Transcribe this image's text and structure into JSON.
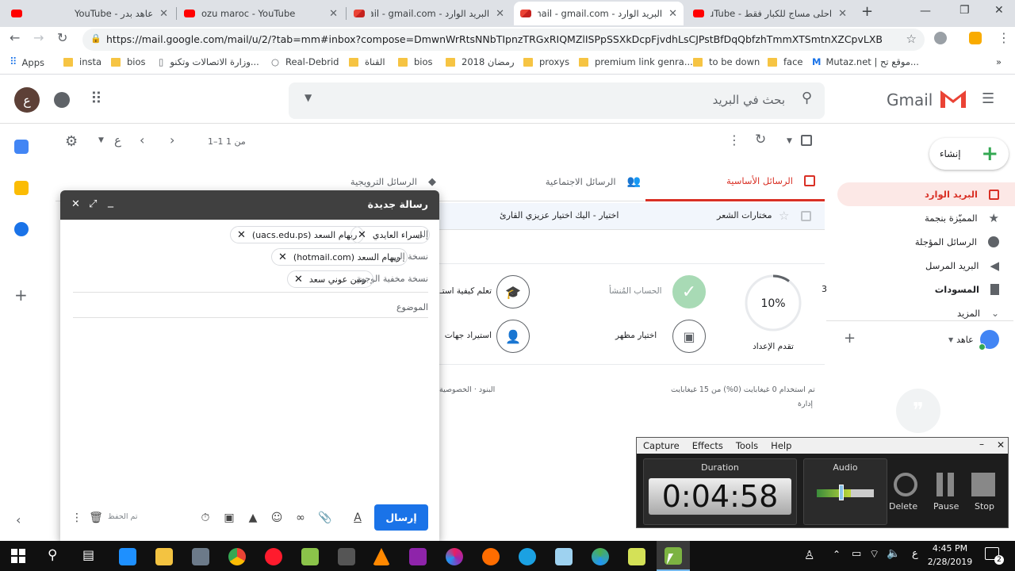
{
  "browser": {
    "tabs": [
      {
        "title": "عاهد بدر - YouTube",
        "icon_color": "#ff0000"
      },
      {
        "title": "ozu maroc - YouTube",
        "icon_color": "#ff0000"
      },
      {
        "title": "البريد الوارد - Gmail - gmail.com",
        "icon_color": "#ea4335"
      },
      {
        "title": "البريد الوارد - Gmail - gmail.com",
        "icon_color": "#ea4335"
      },
      {
        "title": "احلى مساج للكبار فقط - YouTube",
        "icon_color": "#ff0000"
      }
    ],
    "new_tab_label": "+",
    "url": "https://mail.google.com/mail/u/2/?tab=mm#inbox?compose=DmwnWrRtsNNbTIpnzTRGxRIQMZlISPpSSXkDcpFjvdhLsCJPstBfDqQbfzhTmmXTSmtnXZCpvLXB",
    "bookmarks": [
      "Apps",
      "insta",
      "bios",
      "وزارة الاتصالات وتكنو...",
      "Real-Debrid",
      "القناة",
      "bios",
      "رمضان 2018",
      "proxys",
      "premium link genra...",
      "to be down",
      "face",
      "Mutaz.net | موقع تح..."
    ],
    "more_bookmarks": "»"
  },
  "gmail": {
    "logo_text": "Gmail",
    "search_placeholder": "بحث في البريد",
    "avatar_letter": "ع",
    "pager": "1–1 من 1",
    "language_letter": "ع",
    "categories": [
      "الرسائل الأساسية",
      "الرسائل الاجتماعية",
      "الرسائل الترويجية"
    ],
    "row": {
      "sender": "مختارات الشعر",
      "preview": "اختيار - اليك اختيار عزيزي القارئ"
    },
    "compose_button": "إنشاء",
    "nav": [
      {
        "label": "البريد الوارد",
        "count": ""
      },
      {
        "label": "المميّزة بنجمة",
        "count": ""
      },
      {
        "label": "الرسائل المؤجلة",
        "count": ""
      },
      {
        "label": "البريد المرسل",
        "count": ""
      },
      {
        "label": "المسودات",
        "count": "3"
      },
      {
        "label": "المزيد",
        "count": ""
      }
    ],
    "account_name": "عاهد",
    "setup": {
      "progress_percent": 10,
      "progress_label": "10%",
      "progress_caption": "تقدم الإعداد",
      "items": [
        "الحساب المُنشأ",
        "تعلم كيفية استـ",
        "اختيار مظهر",
        "استيراد جهات"
      ]
    },
    "footer": {
      "storage": "تم استخدام 0 غيغابايت (0%) من 15 غيغابايت",
      "manage": "إدارة",
      "terms": "البنود · الخصوصية"
    }
  },
  "compose": {
    "title": "رسالة جديدة",
    "to_label": "إلى",
    "cc_label": "نسخة إلى",
    "bcc_label": "نسخة مخفية الوجهة",
    "subject_placeholder": "الموضوع",
    "to_chips": [
      "اسراء العايدي",
      "ريهام السعد (uacs.edu.ps)"
    ],
    "cc_chips": [
      "ريهام السعد (hotmail.com)"
    ],
    "bcc_chips": [
      "رنين عوني سعد"
    ],
    "send_label": "إرسال",
    "saved_label": "تم الحفظ"
  },
  "capture": {
    "menu": [
      "Capture",
      "Effects",
      "Tools",
      "Help"
    ],
    "duration_label": "Duration",
    "duration": "0:04:58",
    "audio_label": "Audio",
    "buttons": [
      "Delete",
      "Pause",
      "Stop"
    ]
  },
  "taskbar": {
    "time": "4:45 PM",
    "date": "2/28/2019",
    "lang": "ع",
    "notif_count": "2"
  }
}
